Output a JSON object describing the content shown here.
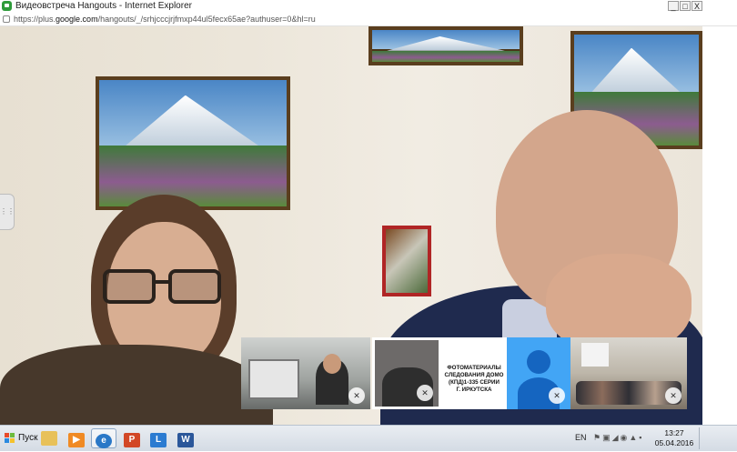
{
  "window": {
    "title": "Видеовстреча Hangouts - Internet Explorer",
    "minimize_glyph": "_",
    "maximize_glyph": "□",
    "close_glyph": "X"
  },
  "address_bar": {
    "url_prefix": "https://plus.",
    "url_host": "google.com",
    "url_rest": "/hangouts/_/srhjcccjrjfmxp44ul5fecx65ae?authuser=0&hl=ru"
  },
  "participants": [
    {
      "name": "participant-1",
      "muted": true
    },
    {
      "name": "participant-2",
      "muted": true
    },
    {
      "name": "participant-3-presentation",
      "muted": false,
      "slide_lines": [
        "ФОТОМАТЕРИАЛЫ",
        "СЛЕДОВАНИЯ ДОМО",
        "(КПД)1-335 СЕРИИ",
        "Г. ИРКУТСКА"
      ]
    },
    {
      "name": "participant-4-avatar",
      "muted": true
    },
    {
      "name": "participant-5",
      "muted": true
    }
  ],
  "side_handle_glyph": "⋮⋮",
  "taskbar": {
    "start_label": "Пуск",
    "apps": [
      {
        "icon": "folder-icon",
        "color": "#e8c15a"
      },
      {
        "icon": "media-player-icon",
        "color": "#f08a24"
      },
      {
        "icon": "internet-explorer-icon",
        "color": "#2a78c7",
        "active": true
      },
      {
        "icon": "powerpoint-icon",
        "color": "#d24726",
        "glyph": "P"
      },
      {
        "icon": "lync-icon",
        "color": "#2b7bd1",
        "glyph": "L"
      },
      {
        "icon": "word-icon",
        "color": "#2b579a",
        "glyph": "W"
      }
    ],
    "language": "EN",
    "tray_icons": [
      "flag-icon",
      "network-icon",
      "volume-icon",
      "update-icon",
      "shield-icon",
      "tray-app-icon"
    ],
    "time": "13:27",
    "date": "05.04.2016"
  }
}
